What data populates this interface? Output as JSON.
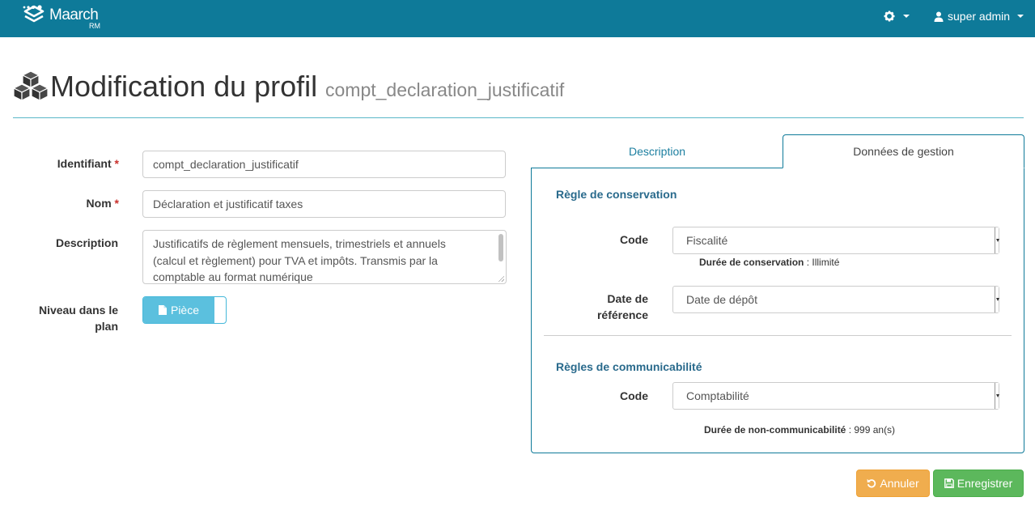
{
  "navbar": {
    "brand_name": "Maarch",
    "brand_sub": "RM",
    "user_label": "super admin"
  },
  "header": {
    "title": "Modification du profil",
    "subtitle": "compt_declaration_justificatif"
  },
  "form": {
    "identifiant": {
      "label": "Identifiant",
      "required_mark": "*",
      "value": "compt_declaration_justificatif"
    },
    "nom": {
      "label": "Nom",
      "required_mark": "*",
      "value": "Déclaration et justificatif taxes"
    },
    "description": {
      "label": "Description",
      "value": "Justificatifs de règlement mensuels, trimestriels et annuels (calcul et règlement) pour TVA et impôts. Transmis par la comptable au format numérique"
    },
    "niveau": {
      "label_line1": "Niveau dans le",
      "label_line2": "plan",
      "toggle_label": "Pièce"
    }
  },
  "tabs": {
    "description": "Description",
    "donnees": "Données de gestion"
  },
  "gestion": {
    "conservation_title": "Règle de conservation",
    "code_label": "Code",
    "code_value": "Fiscalité",
    "duree_label": "Durée de conservation",
    "duree_value": " : Illimité",
    "date_label_line1": "Date de",
    "date_label_line2": "référence",
    "date_value": "Date de dépôt",
    "communicabilite_title": "Règles de communicabilité",
    "comm_code_label": "Code",
    "comm_code_value": "Comptabilité",
    "non_comm_label": "Durée de non-communicabilité",
    "non_comm_value": " : 999 an(s)"
  },
  "buttons": {
    "cancel": "Annuler",
    "save": "Enregistrer"
  },
  "colors": {
    "navbar": "#0e7a99",
    "cancel": "#f0ad4e",
    "save": "#5cb85c",
    "toggle": "#5bc0de"
  }
}
